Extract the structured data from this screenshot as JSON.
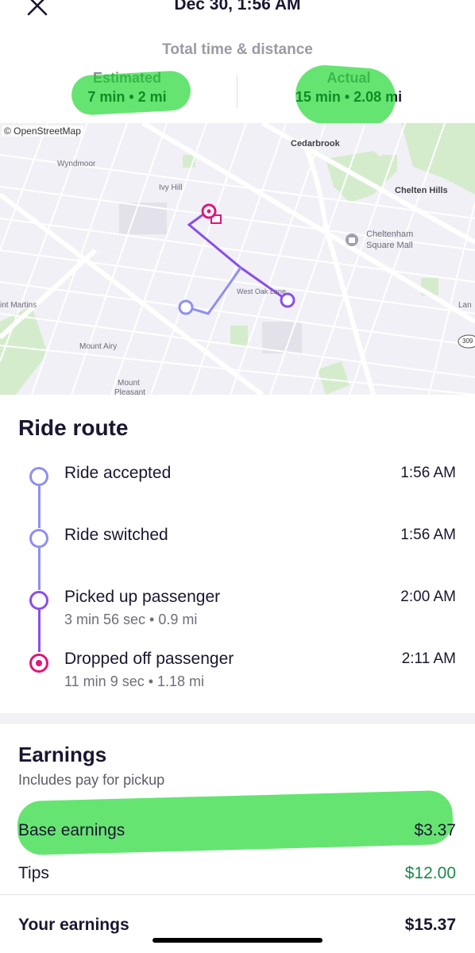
{
  "header": {
    "title": "Dec 30, 1:56 AM",
    "close_icon": "close-icon"
  },
  "summary": {
    "heading": "Total time & distance",
    "estimated_label": "Estimated",
    "estimated_value": "7 min • 2 mi",
    "actual_label": "Actual",
    "actual_value": "15 min • 2.08 mi"
  },
  "map": {
    "attribution": "© OpenStreetMap",
    "labels": {
      "cedarbrook": "Cedarbrook",
      "wyndmoor": "Wyndmoor",
      "ivy_hill": "Ivy Hill",
      "chelten_hills": "Chelten Hills",
      "cheltenham_mall": "Cheltenham",
      "cheltenham_mall2": "Square Mall",
      "west_oak_lane": "West Oak Lane",
      "st_martins": "int Martins",
      "mount_airy": "Mount Airy",
      "mount_pleasant": "Mount",
      "mount_pleasant2": "Pleasant",
      "lan": "Lan",
      "route_309": "309"
    },
    "colors": {
      "route": "#8a4fe8",
      "route_light": "#8f8ff0",
      "dropoff": "#e0167a"
    }
  },
  "ride_route": {
    "title": "Ride route",
    "steps": [
      {
        "label": "Ride accepted",
        "time": "1:56 AM",
        "sub": ""
      },
      {
        "label": "Ride switched",
        "time": "1:56 AM",
        "sub": ""
      },
      {
        "label": "Picked up passenger",
        "time": "2:00 AM",
        "sub": "3 min 56 sec • 0.9 mi"
      },
      {
        "label": "Dropped off passenger",
        "time": "2:11 AM",
        "sub": "11 min 9 sec • 1.18 mi"
      }
    ]
  },
  "earnings": {
    "title": "Earnings",
    "subtitle": "Includes pay for pickup",
    "base_label": "Base earnings",
    "base_value": "$3.37",
    "tips_label": "Tips",
    "tips_value": "$12.00",
    "total_label": "Your earnings",
    "total_value": "$15.37",
    "tips_color": "#1a8a4a"
  }
}
